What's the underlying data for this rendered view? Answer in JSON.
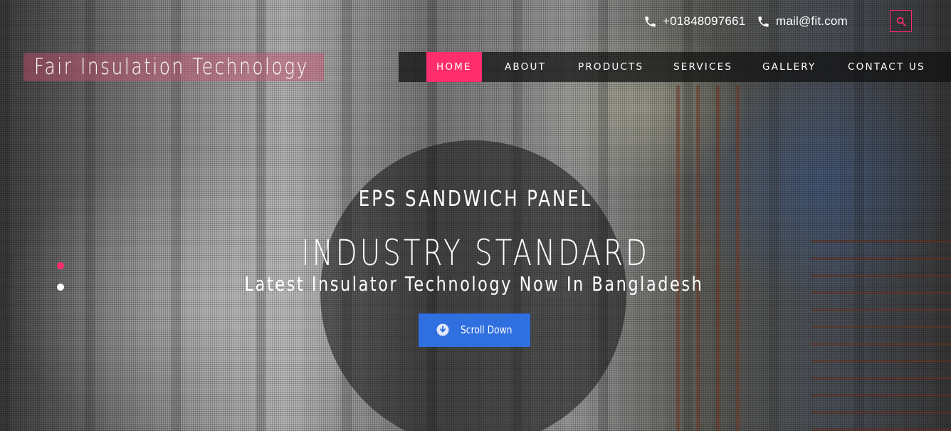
{
  "topbar": {
    "phone": "+01848097661",
    "email": "mail@fit.com",
    "phone_icon": "phone-icon",
    "email_icon": "phone-icon",
    "search_icon": "search-icon"
  },
  "brand": {
    "name": "Fair Insulation Technology"
  },
  "nav": {
    "items": [
      {
        "label": "HOME",
        "active": true
      },
      {
        "label": "ABOUT",
        "active": false
      },
      {
        "label": "PRODUCTS",
        "active": false
      },
      {
        "label": "SERVICES",
        "active": false
      },
      {
        "label": "GALLERY",
        "active": false
      },
      {
        "label": "CONTACT US",
        "active": false
      }
    ]
  },
  "hero": {
    "subtitle": "EPS SANDWICH PANEL",
    "title": "INDUSTRY STANDARD",
    "tagline": "Latest Insulator Technology Now In Bangladesh",
    "button_label": "Scroll Down",
    "button_icon": "arrow-down-circle-icon"
  },
  "slider": {
    "slide_count": 2,
    "active_slide": 1
  },
  "colors": {
    "accent": "#ff2d6b",
    "button": "#2f6fe0",
    "nav_bg": "#0f0f0f"
  }
}
